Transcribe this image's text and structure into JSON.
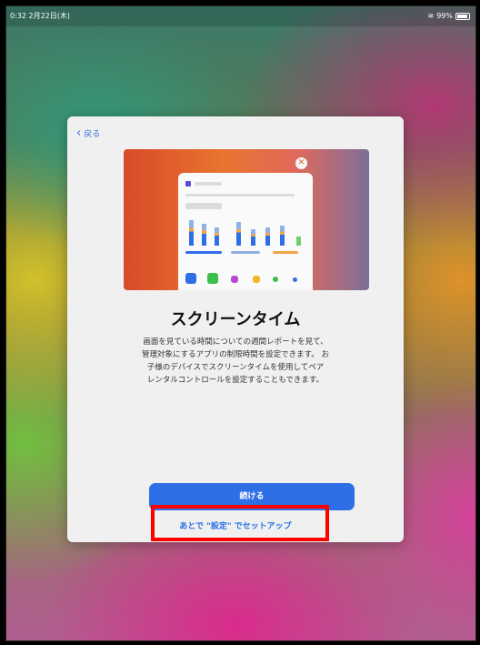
{
  "status_bar": {
    "time_date": "0:32  2月22日(木)",
    "battery_percent": "99%",
    "wifi_icon": "wifi-icon",
    "battery_icon": "battery-icon"
  },
  "sheet": {
    "back_label": "戻る",
    "title": "スクリーンタイム",
    "description_lines": [
      "画面を見ている時間についての週間レポートを見て、",
      "管理対象にするアプリの制限時間を設定できます。 お",
      "子様のデバイスでスクリーンタイムを使用してペア",
      "レンタルコントロールを設定することもできます。"
    ],
    "continue_label": "続ける",
    "later_label": "あとで \"設定\" でセットアップ"
  },
  "colors": {
    "accent_blue": "#2f6fe6",
    "highlight_red": "#ff0000"
  }
}
